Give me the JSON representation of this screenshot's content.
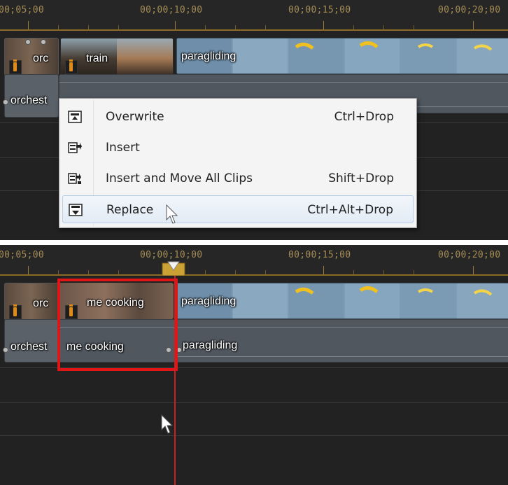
{
  "ruler": {
    "labels": [
      "00;05;00",
      "00;00;10;00",
      "00;00;15;00",
      "00;00;20;00"
    ]
  },
  "top_panel": {
    "clips": {
      "orchestra_video": "orc",
      "train_video": "train",
      "paragliding_video": "paragliding",
      "orchestra_audio": "orchest"
    },
    "context_menu": {
      "items": [
        {
          "label": "Overwrite",
          "shortcut": "Ctrl+Drop",
          "icon": "overwrite-icon"
        },
        {
          "label": "Insert",
          "shortcut": "",
          "icon": "insert-icon"
        },
        {
          "label": "Insert and Move All Clips",
          "shortcut": "Shift+Drop",
          "icon": "insert-move-icon"
        },
        {
          "label": "Replace",
          "shortcut": "Ctrl+Alt+Drop",
          "icon": "replace-icon"
        }
      ],
      "hovered_index": 3
    }
  },
  "bottom_panel": {
    "clips": {
      "orchestra_video": "orc",
      "cooking_video": "me cooking",
      "paragliding_video": "paragliding",
      "orchestra_audio": "orchest",
      "cooking_audio": "me cooking",
      "paragliding_audio": "paragliding"
    },
    "colors": {
      "selection": "#e01515",
      "playhead": "#cc1f1f"
    }
  }
}
